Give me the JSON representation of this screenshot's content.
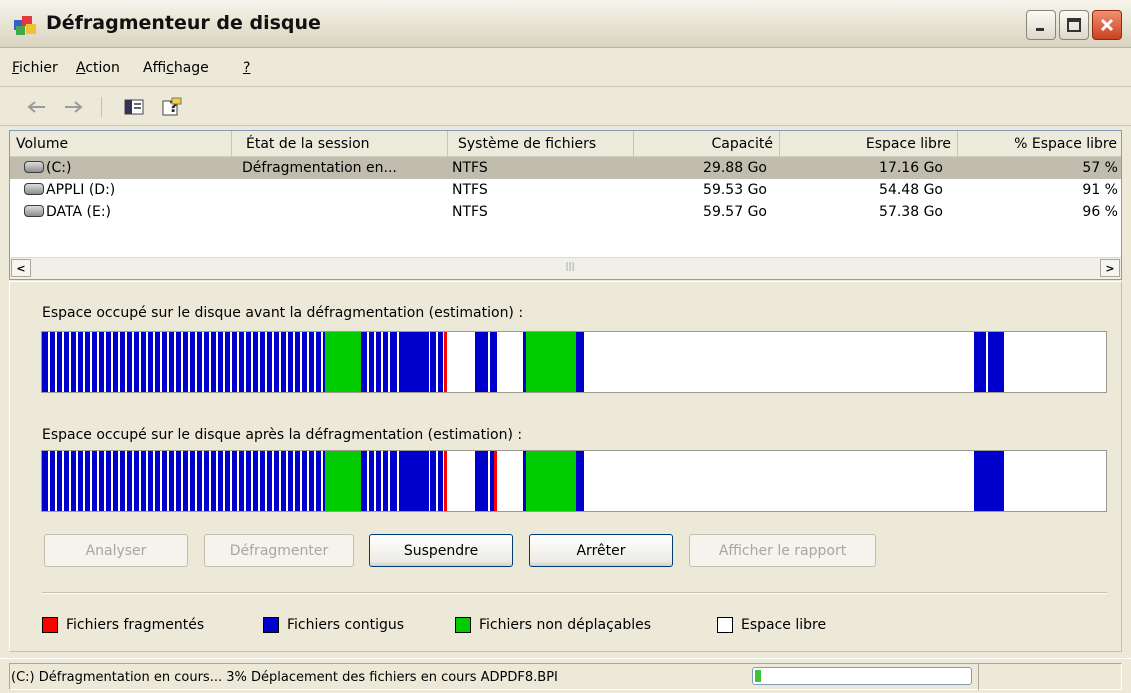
{
  "window": {
    "title": "Défragmenteur de disque"
  },
  "menu": [
    {
      "key": "F",
      "rest": "ichier"
    },
    {
      "key": "A",
      "rest": "ction"
    },
    {
      "pre": "Affi",
      "key": "c",
      "rest": "hage"
    },
    {
      "key": "?",
      "rest": ""
    }
  ],
  "toolbar": {
    "icons": [
      "back-arrow-icon",
      "forward-arrow-icon",
      "show-hide-console-tree-icon",
      "help-icon"
    ]
  },
  "volumes": {
    "columns": [
      "Volume",
      "État de la session",
      "Système de fichiers",
      "Capacité",
      "Espace libre",
      "% Espace libre"
    ],
    "rows": [
      {
        "volume": "(C:)",
        "state": "Défragmentation en...",
        "fs": "NTFS",
        "capacity": "29.88 Go",
        "free": "17.16 Go",
        "pct": "57 %",
        "selected": true
      },
      {
        "volume": "APPLI (D:)",
        "state": "",
        "fs": "NTFS",
        "capacity": "59.53 Go",
        "free": "54.48 Go",
        "pct": "91 %",
        "selected": false
      },
      {
        "volume": "DATA (E:)",
        "state": "",
        "fs": "NTFS",
        "capacity": "59.57 Go",
        "free": "57.38 Go",
        "pct": "96 %",
        "selected": false
      }
    ]
  },
  "analysis": {
    "before_label": "Espace occupé sur le disque avant la défragmentation (estimation) :",
    "after_label": "Espace occupé sur le disque après la défragmentation (estimation) :"
  },
  "buttons": {
    "analyze": "Analyser",
    "defragment": "Défragmenter",
    "pause": "Suspendre",
    "stop": "Arrêter",
    "report": "Afficher le rapport"
  },
  "legend": [
    {
      "label": "Fichiers fragmentés",
      "color": "#ff0000"
    },
    {
      "label": "Fichiers contigus",
      "color": "#0000cc"
    },
    {
      "label": "Fichiers non déplaçables",
      "color": "#00cc00"
    },
    {
      "label": "Espace libre",
      "color": "#ffffff"
    }
  ],
  "status": {
    "text": "(C:) Défragmentation en cours... 3%  Déplacement des fichiers en cours ADPDF8.BPI",
    "progress": 0.03
  },
  "colors": {
    "fragmented": "#ff0000",
    "contiguous": "#0000cc",
    "unmovable": "#00cc00",
    "free": "#ffffff"
  }
}
